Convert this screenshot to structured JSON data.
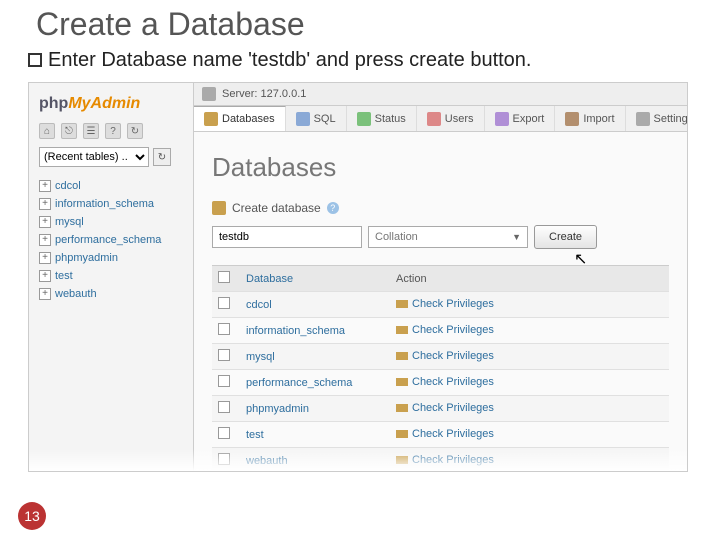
{
  "slide": {
    "title": "Create a Database",
    "instruction": "Enter Database name 'testdb' and press create button.",
    "page_number": "13"
  },
  "sidebar": {
    "logo_php": "php",
    "logo_myadmin": "MyAdmin",
    "recent_placeholder": "(Recent tables) ..",
    "tree": [
      "cdcol",
      "information_schema",
      "mysql",
      "performance_schema",
      "phpmyadmin",
      "test",
      "webauth"
    ]
  },
  "server": {
    "label": "Server: 127.0.0.1"
  },
  "tabs": {
    "items": [
      {
        "label": "Databases",
        "icon": "db",
        "active": true
      },
      {
        "label": "SQL",
        "icon": "sql"
      },
      {
        "label": "Status",
        "icon": "status"
      },
      {
        "label": "Users",
        "icon": "users"
      },
      {
        "label": "Export",
        "icon": "export"
      },
      {
        "label": "Import",
        "icon": "import"
      },
      {
        "label": "Settings",
        "icon": "settings"
      }
    ]
  },
  "content": {
    "heading": "Databases",
    "create_label": "Create database",
    "dbname_value": "testdb",
    "collation_placeholder": "Collation",
    "create_button": "Create",
    "table": {
      "col_db": "Database",
      "col_action": "Action",
      "action_label": "Check Privileges",
      "rows": [
        "cdcol",
        "information_schema",
        "mysql",
        "performance_schema",
        "phpmyadmin",
        "test",
        "webauth"
      ]
    }
  }
}
